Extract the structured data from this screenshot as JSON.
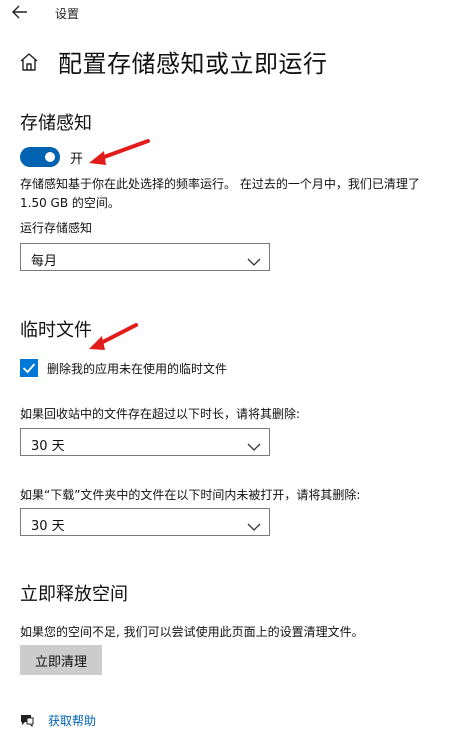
{
  "app": {
    "back_icon": "back-arrow-icon",
    "title": "设置"
  },
  "page": {
    "home_icon": "home-icon",
    "title": "配置存储感知或立即运行"
  },
  "storage_sense": {
    "header": "存储感知",
    "toggle_state": "on",
    "toggle_label": "开",
    "description": "存储感知基于你在此处选择的频率运行。 在过去的一个月中，我们已清理了 1.50 GB 的空间。",
    "run_label": "运行存储感知",
    "run_value": "每月"
  },
  "temp_files": {
    "header": "临时文件",
    "checkbox_checked": true,
    "checkbox_label": "删除我的应用未在使用的临时文件",
    "recycle_label": "如果回收站中的文件存在超过以下时长，请将其删除:",
    "recycle_value": "30 天",
    "downloads_label": "如果“下载”文件夹中的文件在以下时间内未被打开，请将其删除:",
    "downloads_value": "30 天"
  },
  "free_space": {
    "header": "立即释放空间",
    "description": "如果您的空间不足, 我们可以尝试使用此页面上的设置清理文件。",
    "button_label": "立即清理"
  },
  "help": {
    "icon": "help-icon",
    "label": "获取帮助"
  },
  "colors": {
    "accent": "#0063b1",
    "checkbox": "#0078d7",
    "annotation_arrow": "#e21b1b",
    "button_bg": "#cccccc"
  }
}
